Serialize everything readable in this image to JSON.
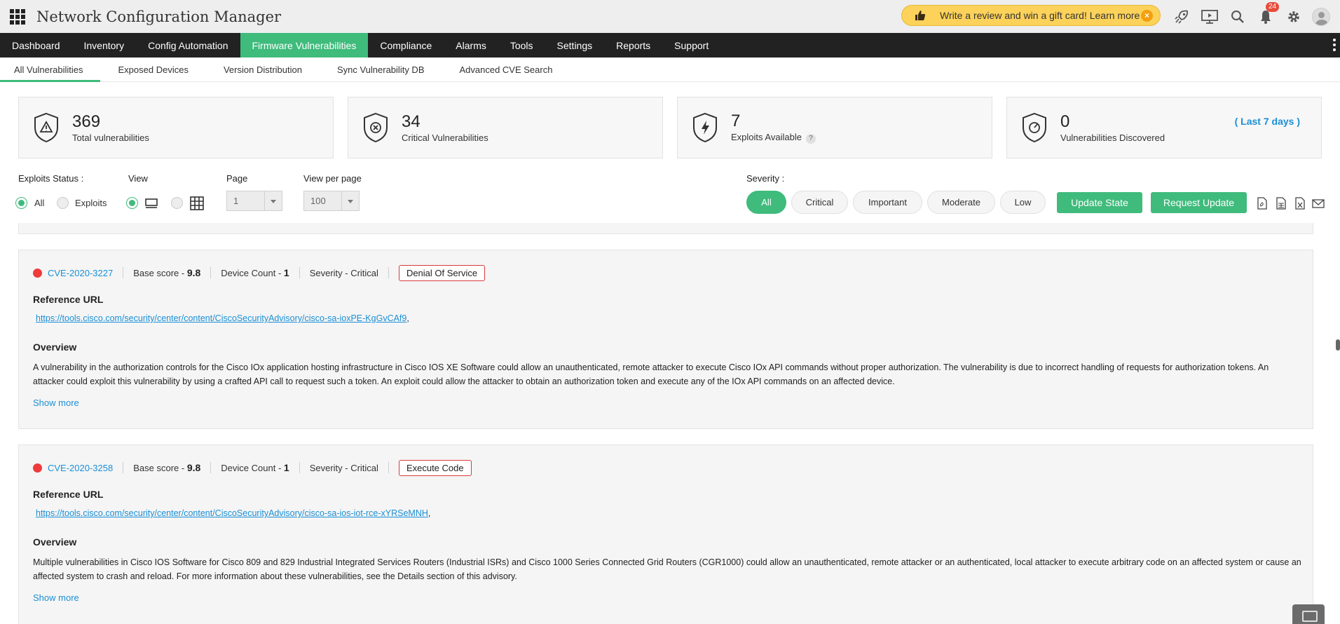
{
  "app": {
    "title": "Network Configuration Manager"
  },
  "promo": {
    "text": "Write a review and win a gift card! Learn more"
  },
  "notifications": {
    "count": "24"
  },
  "nav": {
    "items": [
      {
        "label": "Dashboard"
      },
      {
        "label": "Inventory"
      },
      {
        "label": "Config Automation"
      },
      {
        "label": "Firmware Vulnerabilities",
        "active": true
      },
      {
        "label": "Compliance"
      },
      {
        "label": "Alarms"
      },
      {
        "label": "Tools"
      },
      {
        "label": "Settings"
      },
      {
        "label": "Reports"
      },
      {
        "label": "Support"
      }
    ]
  },
  "subnav": {
    "items": [
      {
        "label": "All Vulnerabilities",
        "active": true
      },
      {
        "label": "Exposed Devices"
      },
      {
        "label": "Version Distribution"
      },
      {
        "label": "Sync Vulnerability DB"
      },
      {
        "label": "Advanced CVE Search"
      }
    ]
  },
  "stats": [
    {
      "value": "369",
      "label": "Total vulnerabilities"
    },
    {
      "value": "34",
      "label": "Critical Vulnerabilities"
    },
    {
      "value": "7",
      "label": "Exploits Available",
      "help": "?"
    },
    {
      "value": "0",
      "label": "Vulnerabilities Discovered",
      "period": "( Last 7 days )"
    }
  ],
  "filters": {
    "exploits_label": "Exploits Status :",
    "exploits_all": "All",
    "exploits_exploits": "Exploits",
    "view_label": "View",
    "page_label": "Page",
    "page_value": "1",
    "per_page_label": "View per page",
    "per_page_value": "100",
    "severity_label": "Severity :",
    "severity_options": [
      "All",
      "Critical",
      "Important",
      "Moderate",
      "Low"
    ],
    "update_state": "Update State",
    "request_update": "Request Update"
  },
  "vulnerabilities": [
    {
      "cve": "CVE-2020-3227",
      "base_score_label": "Base score - ",
      "base_score": "9.8",
      "device_count_label": "Device Count - ",
      "device_count": "1",
      "severity": "Severity - Critical",
      "type": "Denial Of Service",
      "ref_heading": "Reference URL",
      "url": "https://tools.cisco.com/security/center/content/CiscoSecurityAdvisory/cisco-sa-ioxPE-KgGvCAf9",
      "overview_heading": "Overview",
      "overview": "A vulnerability in the authorization controls for the Cisco IOx application hosting infrastructure in Cisco IOS XE Software could allow an unauthenticated, remote attacker to execute Cisco IOx API commands without proper authorization. The vulnerability is due to incorrect handling of requests for authorization tokens. An attacker could exploit this vulnerability by using a crafted API call to request such a token. An exploit could allow the attacker to obtain an authorization token and execute any of the IOx API commands on an affected device.",
      "show_more": "Show more"
    },
    {
      "cve": "CVE-2020-3258",
      "base_score_label": "Base score - ",
      "base_score": "9.8",
      "device_count_label": "Device Count - ",
      "device_count": "1",
      "severity": "Severity - Critical",
      "type": "Execute Code",
      "ref_heading": "Reference URL",
      "url": "https://tools.cisco.com/security/center/content/CiscoSecurityAdvisory/cisco-sa-ios-iot-rce-xYRSeMNH",
      "overview_heading": "Overview",
      "overview": "Multiple vulnerabilities in Cisco IOS Software for Cisco 809 and 829 Industrial Integrated Services Routers (Industrial ISRs) and Cisco 1000 Series Connected Grid Routers (CGR1000) could allow an unauthenticated, remote attacker or an authenticated, local attacker to execute arbitrary code on an affected system or cause an affected system to crash and reload. For more information about these vulnerabilities, see the Details section of this advisory.",
      "show_more": "Show more"
    }
  ],
  "colors": {
    "accent_green": "#3fbb7c",
    "nav_dark": "#222222",
    "link_blue": "#1a8fd6",
    "critical_red": "#ef3b3b",
    "promo_yellow": "#fcd25a"
  },
  "icons": {
    "app_menu": "grid-icon",
    "promo": "thumbs-up-icon",
    "launch": "rocket-icon",
    "presentation": "presentation-icon",
    "search": "search-icon",
    "notifications": "bell-icon",
    "settings": "gear-icon",
    "user": "avatar-icon"
  }
}
